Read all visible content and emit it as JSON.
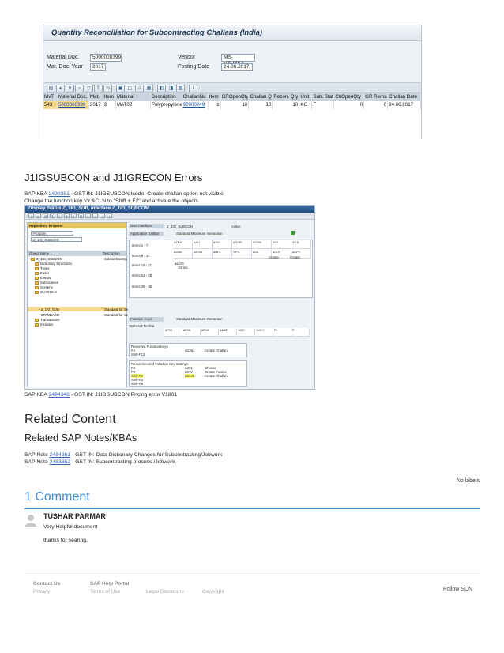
{
  "sap_screen1": {
    "title": "Quantity Reconciliation for Subcontracting Challans (India)",
    "fields": {
      "material_doc_label": "Material Doc.",
      "material_doc_value": "5000000399",
      "mat_doc_year_label": "Mat. Doc. Year",
      "mat_doc_year_value": "2017",
      "vendor_label": "Vendor",
      "vendor_value": "MS-VSUBKA",
      "posting_date_label": "Posting Date",
      "posting_date_value": "24.06.2017"
    },
    "grid": {
      "headers": [
        "MvT",
        "Material Doc.",
        "Mat.",
        "Item",
        "Material",
        "Description",
        "ChallanNu",
        "Item",
        "GROpenQty",
        "Challan Qt",
        "Recon. Qty",
        "Unit",
        "Sub. Stat",
        "ChOpenQty",
        "GR Rema",
        "Challan Date"
      ],
      "rows": [
        [
          "543",
          "5000000399",
          "2017",
          "2",
          "MAT02",
          "Polypropylene",
          "90000249",
          "1",
          "10",
          "10",
          "10",
          "KG",
          "F",
          "0",
          "0",
          "24.06.2017"
        ]
      ]
    }
  },
  "section1": {
    "heading": "J1IGSUBCON and J1IGRECON Errors",
    "kba_prefix": "SAP KBA ",
    "kba_number": "2490351",
    "kba_suffix": " - GST IN: J1IGSUBCON tcode- Create challan option not visible",
    "instruction": "Change the function key for &CLN to \"Shift + F2\" and activate the objects."
  },
  "sap_screen2": {
    "title": "Display Status Z_1IG_SUB, Interface Z_1IG_SUBCON",
    "repo_browser": "Repository Browser",
    "program_select": "Program",
    "program_value": "Z_1IG_SUBCON",
    "tree_col_name": "Object Name",
    "tree_col_desc": "Description",
    "tree_items": [
      "Z_1IG_SUBCON",
      "Dictionary Structures",
      "Types",
      "Fields",
      "Events",
      "Subroutines",
      "Screens",
      "GUI Status",
      "Z_1IG_SUB",
      "STANDARD",
      "Transactions",
      "Includes"
    ],
    "tree_desc_root": "Subcontracting",
    "tree_desc_sub1": "Standard for Se",
    "tree_desc_sub2": "Standard for Se",
    "user_interface_label": "User Interface",
    "user_interface_value": "Z_1IG_SUBCON",
    "active_label": "Active",
    "app_toolbar_label": "Application Toolbar",
    "std_interaction": "Standard Maximum Interaction",
    "items_1_7": "Items  1 - 7",
    "items_8_14": "Items  8 - 14",
    "items_15_21": "Items 15 - 21",
    "items_22_28": "Items 22 - 28",
    "items_29_35": "Items 29 - 35",
    "codes_row1": [
      "&TBA",
      "&ALL",
      "&SAL",
      "&SOR",
      "&ODN",
      "&ILT",
      "&ILD"
    ],
    "codes_row2": [
      "&CMC",
      "&EOM",
      "&REL",
      "%PC",
      "&OL",
      "&CLN",
      "&CPY"
    ],
    "create_label1": "Create",
    "create_label2": "Create",
    "row3_code": "&LOG",
    "row3_text": "Errors",
    "function_keys_label": "Function Keys",
    "std_toolbar_label": "Standard Toolbar",
    "std_codes": [
      "&F03",
      "&F15",
      "&F12",
      "&ABT",
      "%SC",
      "%SC+",
      "P+",
      "P-"
    ],
    "recommended_keys_label": "Reserved Function Keys",
    "f4_label": "F4",
    "shift_f12": "Shift-F12",
    "cnl_code": "&CNL",
    "create_challan": "Create Challan",
    "recommended_settings_label": "Recommended Function Key Settings",
    "rec_keys": [
      "F2",
      "F9",
      "Shift-F2",
      "Shift-F4",
      "Shift-F5"
    ],
    "rec_codes": [
      "&IC1",
      "&INV",
      "&CLN"
    ],
    "rec_texts": [
      "Choose",
      "Create Invoice",
      "Create Challan"
    ]
  },
  "section2": {
    "kba_prefix": "SAP KBA ",
    "kba_number": "2494348",
    "kba_suffix": " - GST IN: J1IGSUBCON Pricing error V1801"
  },
  "related": {
    "heading": "Related Content",
    "subheading": "Related SAP Notes/KBAs",
    "note1_prefix": "SAP Note ",
    "note1_number": "2484361",
    "note1_suffix": " - GST IN: Data Dictionary Changes for Subcontracting/Jobwork",
    "note2_prefix": "SAP Note ",
    "note2_number": "2483852",
    "note2_suffix": " - GST IN: Subcontracting process /Jobwork"
  },
  "labels_text": "No labels",
  "comments": {
    "title": "1 Comment",
    "author": "TUSHAR PARMAR",
    "line1": "Very Helpful document",
    "line2": "thanks for searing."
  },
  "footer": {
    "contact": "Contact Us",
    "help": "SAP Help Portal",
    "privacy": "Privacy",
    "terms": "Terms of Use",
    "legal": "Legal Disclosure",
    "copyright": "Copyright",
    "follow": "Follow SCN"
  },
  "colors": {
    "link": "#3366bb",
    "comments_accent": "#3e8bd8",
    "sap_highlight": "#f6d98a"
  }
}
